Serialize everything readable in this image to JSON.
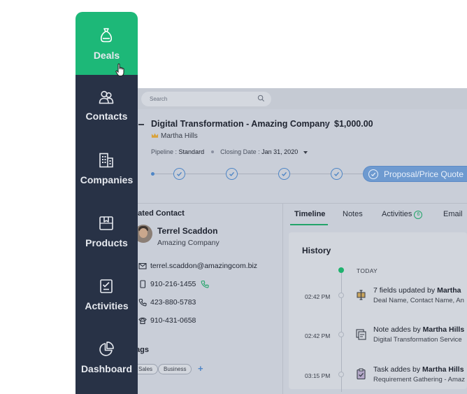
{
  "sidebar": {
    "items": [
      {
        "label": "Deals",
        "icon": "money-bag-icon",
        "active": true
      },
      {
        "label": "Contacts",
        "icon": "contacts-icon",
        "active": false
      },
      {
        "label": "Companies",
        "icon": "building-icon",
        "active": false
      },
      {
        "label": "Products",
        "icon": "box-icon",
        "active": false
      },
      {
        "label": "Activities",
        "icon": "checklist-icon",
        "active": false
      },
      {
        "label": "Dashboard",
        "icon": "pie-chart-icon",
        "active": false
      }
    ],
    "active_color": "#1db878",
    "bg_color": "#283246"
  },
  "search": {
    "placeholder": "Search"
  },
  "deal": {
    "title": "Digital Transformation - Amazing Company",
    "amount": "$1,000.00",
    "owner": "Martha Hills",
    "pipeline_label": "Pipeline :",
    "pipeline_value": "Standard",
    "closing_label": "Closing Date :",
    "closing_value": "Jan 31, 2020",
    "current_stage": "Proposal/Price Quote",
    "completed_stages": 4
  },
  "related": {
    "title": "elated Contact",
    "name": "Terrel Scaddon",
    "company": "Amazing Company",
    "email": "terrel.scaddon@amazingcom.biz",
    "phones": [
      "910-216-1455",
      "423-880-5783",
      "910-431-0658"
    ]
  },
  "tags": {
    "title": "ags",
    "items": [
      "Sales",
      "Business"
    ],
    "add_label": "+"
  },
  "tabs": {
    "items": [
      "Timeline",
      "Notes",
      "Activities",
      "Email"
    ],
    "activities_count": "6",
    "active": "Timeline"
  },
  "history": {
    "title": "History",
    "today_label": "TODAY",
    "entries": [
      {
        "time": "02:42 PM",
        "action": "7 fields updated by",
        "actor": "Martha",
        "detail": "Deal Name, Contact Name, An",
        "icon": "fields-update-icon"
      },
      {
        "time": "02:42 PM",
        "action": "Note addes by",
        "actor": "Martha Hills",
        "detail": "Digital Transformation Service",
        "icon": "note-icon"
      },
      {
        "time": "03:15 PM",
        "action": "Task addes by",
        "actor": "Martha Hills",
        "detail": "Requirement Gathering - Amaz",
        "icon": "task-icon"
      }
    ]
  }
}
